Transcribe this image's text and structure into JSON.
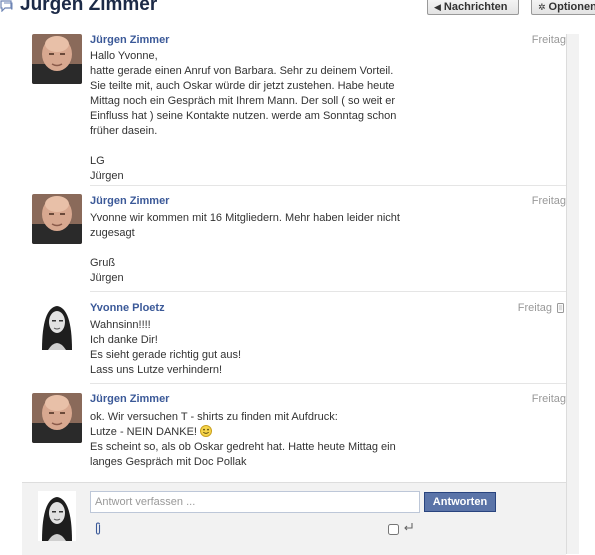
{
  "header": {
    "title": "Jürgen Zimmer",
    "title_icon": "messages-icon",
    "back_label": "Nachrichten",
    "options_label": "Optionen"
  },
  "messages": [
    {
      "author": "Jürgen Zimmer",
      "time": "Freitag",
      "avatar": "bald-man-photo",
      "lines": [
        "Hallo Yvonne,",
        "hatte gerade einen Anruf von Barbara. Sehr zu deinem Vorteil.",
        "Sie teilte mit, auch Oskar würde dir jetzt zustehen. Habe heute",
        "Mittag noch ein Gespräch mit Ihrem Mann. Der soll ( so weit er",
        "Einfluss hat ) seine Kontakte nutzen. werde am Sonntag schon",
        "früher dasein.",
        "",
        "LG",
        "Jürgen"
      ]
    },
    {
      "author": "Jürgen Zimmer",
      "time": "Freitag",
      "avatar": "bald-man-photo",
      "lines": [
        "Yvonne wir kommen mit 16 Mitgliedern. Mehr haben leider nicht",
        "zugesagt",
        "",
        "Gruß",
        "Jürgen"
      ]
    },
    {
      "author": "Yvonne Ploetz",
      "time": "Freitag",
      "time_icon": "mobile-phone-icon",
      "avatar": "woman-photo-bw",
      "lines": [
        "Wahnsinn!!!!",
        "Ich danke Dir!",
        "Es sieht gerade richtig gut aus!",
        "Lass uns Lutze verhindern!"
      ]
    },
    {
      "author": "Jürgen Zimmer",
      "time": "Freitag",
      "avatar": "bald-man-photo",
      "lines": [
        "ok. Wir versuchen T - shirts zu finden mit Aufdruck:",
        "Lutze - NEIN DANKE!",
        "Es scheint so, als ob Oskar gedreht hat. Hatte heute Mittag ein",
        "langes Gespräch mit Doc Pollak"
      ],
      "emoticon_after_line": 1,
      "emoticon": "smiley-icon"
    }
  ],
  "composer": {
    "placeholder": "Antwort verfassen ...",
    "value": "",
    "reply_label": "Antworten",
    "attach_icon": "paperclip-icon",
    "enter_icon": "enter-key-icon",
    "enter_to_send_checked": false
  },
  "colors": {
    "link": "#3b5998",
    "title": "#1c2a47",
    "button": "#5b74a8",
    "muted": "#999999"
  }
}
